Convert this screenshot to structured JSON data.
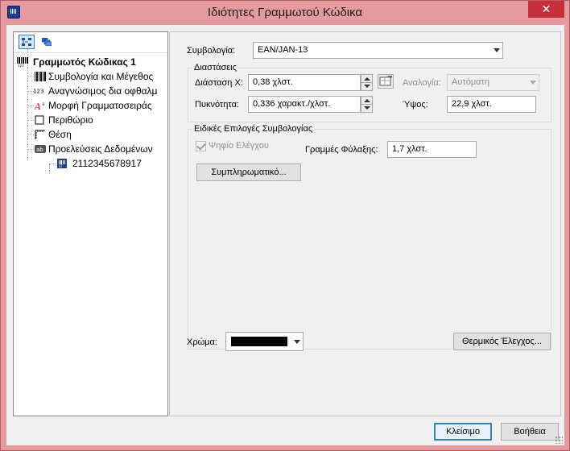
{
  "window": {
    "title": "Ιδιότητες Γραμμωτού Κώδικα",
    "close_label": "✕"
  },
  "tree": {
    "items": [
      {
        "label": "Γραμμωτός Κώδικας 1",
        "icon": "barcode-icon"
      },
      {
        "label": "Συμβολογία και Μέγεθος",
        "icon": "barcode-bars-icon"
      },
      {
        "label": "Αναγνώσιμος δια οφθαλμ",
        "icon": "digits-123-icon"
      },
      {
        "label": "Μορφή Γραμματοσειράς",
        "icon": "font-icon"
      },
      {
        "label": "Περιθώριο",
        "icon": "border-icon"
      },
      {
        "label": "Θέση",
        "icon": "position-icon"
      },
      {
        "label": "Προελεύσεις Δεδομένων",
        "icon": "data-source-icon"
      },
      {
        "label": "2112345678917",
        "icon": "data-item-icon"
      }
    ]
  },
  "symbology": {
    "label": "Συμβολογία:",
    "value": "EAN/JAN-13"
  },
  "dimensions": {
    "group_title": "Διαστάσεις",
    "x_label": "Διάσταση Χ:",
    "x_value": "0,38 χλστ.",
    "ratio_label": "Αναλογία:",
    "ratio_value": "Αυτόματη",
    "density_label": "Πυκνότητα:",
    "density_value": "0,336  χαρακτ./χλστ.",
    "height_label": "Ύψος:",
    "height_value": "22,9        χλστ."
  },
  "special": {
    "group_title": "Ειδικές Επιλογές Συμβολογίας",
    "check_digit_label": "Ψηφίο Ελέγχου",
    "guard_bars_label": "Γραμμές Φύλαξης:",
    "guard_bars_value": "1,7             χλστ.",
    "supplementary_button": "Συμπληρωματικό..."
  },
  "color": {
    "label": "Χρώμα:",
    "value_hex": "#000000"
  },
  "buttons": {
    "thermal_check": "Θερμικός Έλεγχος...",
    "close": "Κλείσιμο",
    "help": "Βοήθεια"
  },
  "colors": {
    "titlebar": "#e59aa0",
    "close_button": "#c7303b",
    "accent": "#3c7fb1"
  }
}
